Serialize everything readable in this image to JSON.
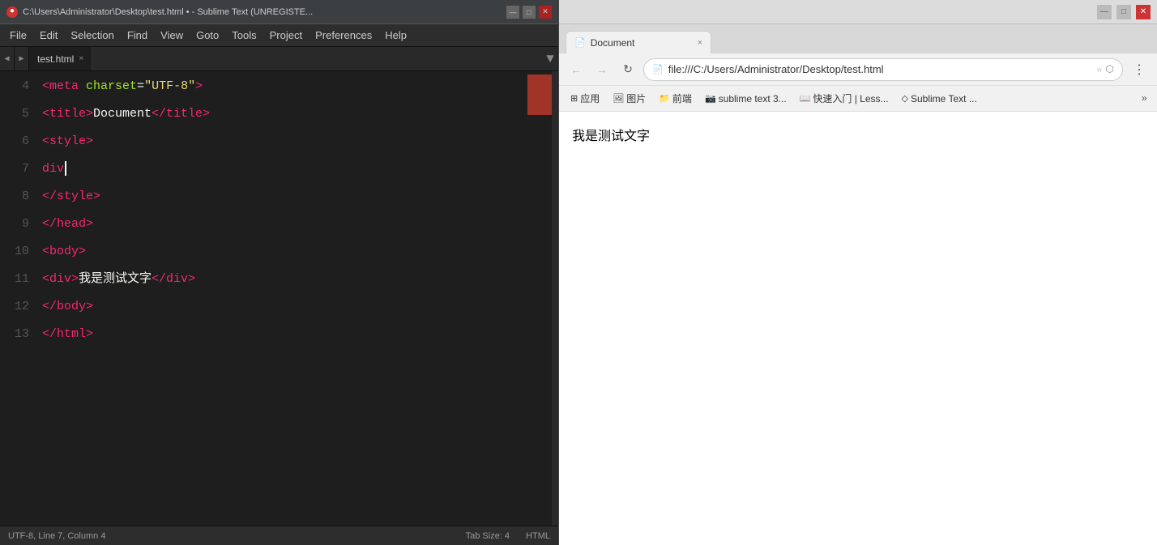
{
  "sublime": {
    "title_bar": {
      "path": "C:\\Users\\Administrator\\Desktop\\test.html • - Sublime Text (UNREGISTE...",
      "icon": "●"
    },
    "menu_items": [
      "File",
      "Edit",
      "Selection",
      "Find",
      "View",
      "Goto",
      "Tools",
      "Project",
      "Preferences",
      "Help"
    ],
    "tab": {
      "name": "test.html",
      "close": "×"
    },
    "lines": [
      {
        "num": "4",
        "html": "<span class='tag'>&lt;meta</span> <span class='attr-name'>charset</span><span class='white'>=</span><span class='attr-val'>\"UTF-8\"</span><span class='tag'>&gt;</span>"
      },
      {
        "num": "5",
        "html": "<span class='tag'>&lt;title&gt;</span><span class='white'>Document</span><span class='tag'>&lt;/title&gt;</span>"
      },
      {
        "num": "6",
        "html": "<span class='tag'>&lt;style&gt;</span>"
      },
      {
        "num": "7",
        "html": "<span class='pink'>div</span>"
      },
      {
        "num": "8",
        "html": "<span class='tag'>&lt;/style&gt;</span>"
      },
      {
        "num": "9",
        "html": "<span class='tag'>&lt;/head&gt;</span>"
      },
      {
        "num": "10",
        "html": "<span class='tag'>&lt;body&gt;</span>"
      },
      {
        "num": "11",
        "html": "<span class='tag'>&lt;div&gt;</span><span class='white'>我是测试文字</span><span class='tag'>&lt;/div&gt;</span>"
      },
      {
        "num": "12",
        "html": "<span class='tag'>&lt;/body&gt;</span>"
      },
      {
        "num": "13",
        "html": "<span class='tag'>&lt;/html&gt;</span>"
      }
    ],
    "status": {
      "encoding": "UTF-8, Line 7, Column 4",
      "tab_size": "Tab Size: 4",
      "syntax": "HTML"
    }
  },
  "browser": {
    "title_bar": {
      "minimize": "—",
      "maximize": "□",
      "close": "✕"
    },
    "tab": {
      "title": "Document",
      "close": "×"
    },
    "toolbar": {
      "back": "←",
      "forward": "→",
      "refresh": "↻",
      "address": "file:///C:/Users/Administrator/Desktop/test.html"
    },
    "bookmarks": [
      {
        "icon": "⊞",
        "label": "应用"
      },
      {
        "icon": "🖼",
        "label": "图片"
      },
      {
        "icon": "📁",
        "label": "前端"
      },
      {
        "icon": "📷",
        "label": "sublime text 3..."
      },
      {
        "icon": "📖",
        "label": "快速入门 | Less..."
      },
      {
        "icon": "◇",
        "label": "Sublime Text ..."
      }
    ],
    "more_bookmarks": "»",
    "content": {
      "text": "我是测试文字"
    }
  }
}
